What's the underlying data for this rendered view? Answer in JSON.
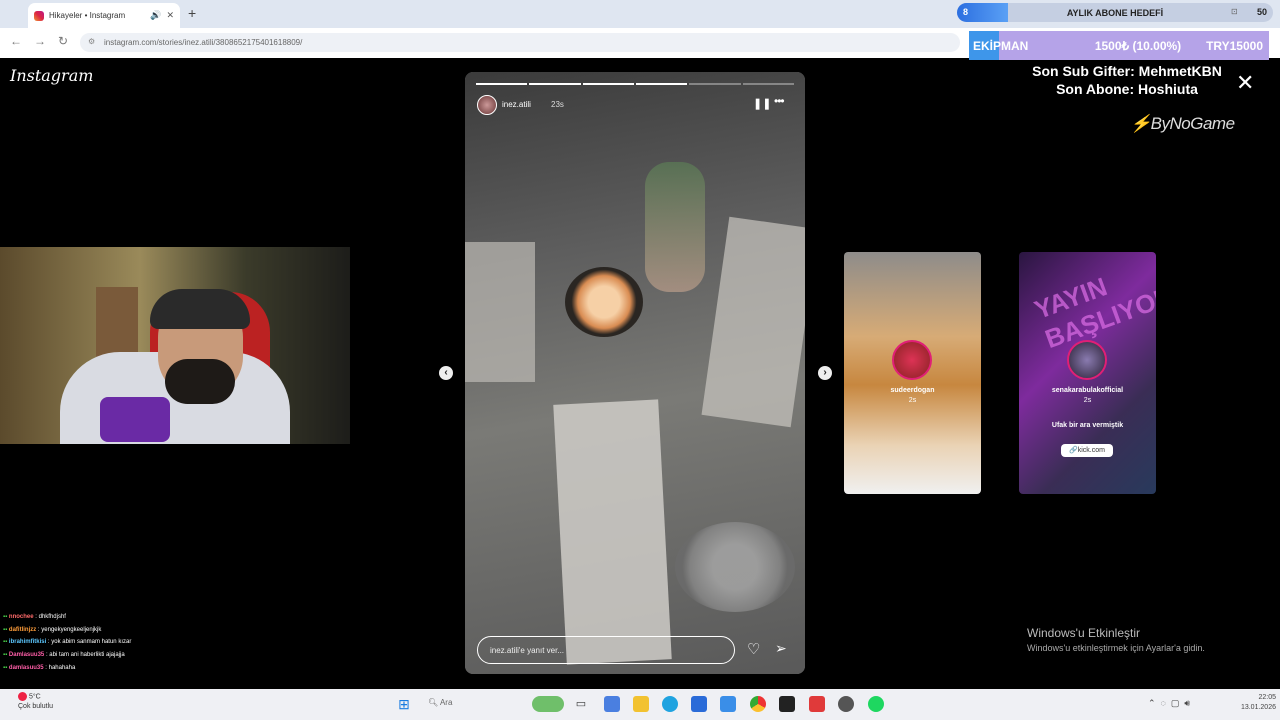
{
  "browser": {
    "tab_title": "Hikayeler • Instagram",
    "tab_mute_icon": "speaker-icon",
    "tab_close": "✕",
    "new_tab": "+",
    "back": "←",
    "forward": "→",
    "reload": "↻",
    "url": "instagram.com/stories/inez.atili/3808652175401618809/"
  },
  "overlay": {
    "goal_start": "8",
    "goal_title": "AYLIK ABONE HEDEFİ",
    "goal_end": "50",
    "goal_progress": 0.16,
    "equipment_label": "EKİPMAN",
    "equipment_amount": "1500₺ (10.00%)",
    "equipment_target": "TRY15000",
    "equipment_progress": 0.1,
    "last_gifter": "Son Sub Gifter: MehmetKBN",
    "last_sub": "Son Abone: Hoshiuta",
    "sponsor": "ByNoGame"
  },
  "instagram": {
    "logo": "Instagram",
    "close_icon": "✕",
    "story": {
      "username": "inez.atili",
      "time": "23s",
      "reply_placeholder": "inez.atili'e yanıt ver...",
      "progress_total": 6,
      "progress_done": 4
    },
    "previews": [
      {
        "username": "sudeerdogan",
        "time": "2s"
      },
      {
        "username": "senakarabulakofficial",
        "time": "2s",
        "big_text": "YAYIN BAŞLIYOR",
        "caption": "Ufak bir ara vermiştik",
        "link": "🔗kick.com"
      }
    ]
  },
  "chat": [
    {
      "name": "nnochee",
      "color": "#ff6a6a",
      "msg": "dhkfhdjshf"
    },
    {
      "name": "dafitlinjzz",
      "color": "#ff9d3a",
      "msg": "yengekyengkeeljenjkjk"
    },
    {
      "name": "ibrahimfitkisi",
      "color": "#5cc8ff",
      "msg": "yok abim sanmam hatun kızar"
    },
    {
      "name": "Damlasuu35",
      "color": "#ff5ea8",
      "msg": "abi tam ani haberlikti ajajajja"
    },
    {
      "name": "damlasuu35",
      "color": "#ff5ea8",
      "msg": "hahahaha"
    }
  ],
  "watermark": {
    "title": "Windows'u Etkinleştir",
    "subtitle": "Windows'u etkinleştirmek için Ayarlar'a gidin."
  },
  "taskbar": {
    "weather_temp": "5°C",
    "weather_desc": "Çok bulutlu",
    "search_placeholder": "Ara",
    "time": "22:05",
    "date": "13.01.2026"
  }
}
